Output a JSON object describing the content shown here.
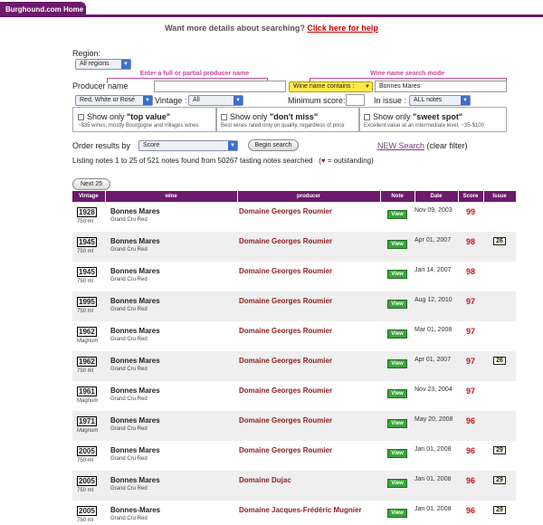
{
  "nav": {
    "home_tab": "Burghound.com Home"
  },
  "more_details": {
    "text": "Want more details about searching?",
    "link": "Click here for help"
  },
  "search": {
    "region_label": "Region:",
    "region_value": "All regions",
    "producer_hint": "Enter a full or partial producer name",
    "wine_hint": "Wine name search mode",
    "producer_label": "Producer name",
    "producer_value": "",
    "wine_mode": "Wine name contains :",
    "wine_value": "Bonnes Mares",
    "color_value": "Red, White or Rosé",
    "vintage_label": "Vintage :",
    "vintage_value": "All",
    "min_score_label": "Minimum score:",
    "min_score_value": "",
    "issue_label": "In issue :",
    "issue_value": "ALL notes"
  },
  "filters": [
    {
      "prefix": "Show only ",
      "name": "\"top value\"",
      "desc": "~$35 wines; mostly Bourgogne and Villages wines"
    },
    {
      "prefix": "Show only ",
      "name": "\"don't miss\"",
      "desc": "Best wines rated only on quality, regardless of price"
    },
    {
      "prefix": "Show only ",
      "name": "\"sweet spot\"",
      "desc": "Excellent value at an intermediate level, ~35-$100"
    }
  ],
  "order": {
    "label": "Order results by",
    "value": "Score",
    "begin_button": "Begin search",
    "new_search": "NEW Search",
    "clear_filter": "(clear filter)"
  },
  "listing": {
    "text": "Listing notes 1 to 25 of 521 notes found from 50267 tasting notes searched",
    "legend_symbol": "♥",
    "legend_text": "= outstanding)",
    "legend_open": "(",
    "next_button": "Next 25"
  },
  "table": {
    "headers": [
      "Vintage",
      "wine",
      "producer",
      "Note",
      "Date",
      "Score",
      "Issue"
    ],
    "view_label": "View",
    "rows": [
      {
        "vintage": "1928",
        "size": "750 ml",
        "wine": "Bonnes Mares",
        "sub": "Grand Cru Red",
        "producer": "Domaine Georges Roumier",
        "date": "Nov 09, 2003",
        "score": "99",
        "issue": ""
      },
      {
        "vintage": "1945",
        "size": "750 ml",
        "wine": "Bonnes Mares",
        "sub": "Grand Cru Red",
        "producer": "Domaine Georges Roumier",
        "date": "Apr 01, 2007",
        "score": "98",
        "issue": "26"
      },
      {
        "vintage": "1945",
        "size": "750 ml",
        "wine": "Bonnes Mares",
        "sub": "Grand Cru Red",
        "producer": "Domaine Georges Roumier",
        "date": "Jan 14, 2007",
        "score": "98",
        "issue": ""
      },
      {
        "vintage": "1995",
        "size": "750 ml",
        "wine": "Bonnes Mares",
        "sub": "Grand Cru Red",
        "producer": "Domaine Georges Roumier",
        "date": "Aug 12, 2010",
        "score": "97",
        "issue": ""
      },
      {
        "vintage": "1962",
        "size": "Magnum",
        "wine": "Bonnes Mares",
        "sub": "Grand Cru Red",
        "producer": "Domaine Georges Roumier",
        "date": "Mar 01, 2008",
        "score": "97",
        "issue": ""
      },
      {
        "vintage": "1962",
        "size": "750 ml",
        "wine": "Bonnes Mares",
        "sub": "Grand Cru Red",
        "producer": "Domaine Georges Roumier",
        "date": "Apr 01, 2007",
        "score": "97",
        "issue": "26"
      },
      {
        "vintage": "1961",
        "size": "Magnum",
        "wine": "Bonnes Mares",
        "sub": "Grand Cru Red",
        "producer": "Domaine Georges Roumier",
        "date": "Nov 23, 2004",
        "score": "97",
        "issue": ""
      },
      {
        "vintage": "1971",
        "size": "Magnum",
        "wine": "Bonnes Mares",
        "sub": "Grand Cru Red",
        "producer": "Domaine Georges Roumier",
        "date": "May 20, 2008",
        "score": "96",
        "issue": ""
      },
      {
        "vintage": "2005",
        "size": "750 ml",
        "wine": "Bonnes Mares",
        "sub": "Grand Cru Red",
        "producer": "Domaine Georges Roumier",
        "date": "Jan 01, 2008",
        "score": "96",
        "issue": "29"
      },
      {
        "vintage": "2005",
        "size": "750 ml",
        "wine": "Bonnes Mares",
        "sub": "Grand Cru Red",
        "producer": "Domaine Dujac",
        "date": "Jan 01, 2008",
        "score": "96",
        "issue": "29"
      },
      {
        "vintage": "2005",
        "size": "750 ml",
        "wine": "Bonnes-Mares",
        "sub": "Grand Cru Red",
        "producer": "Domaine Jacques-Frédéric Mugnier",
        "date": "Jan 01, 2008",
        "score": "96",
        "issue": "29"
      }
    ]
  }
}
